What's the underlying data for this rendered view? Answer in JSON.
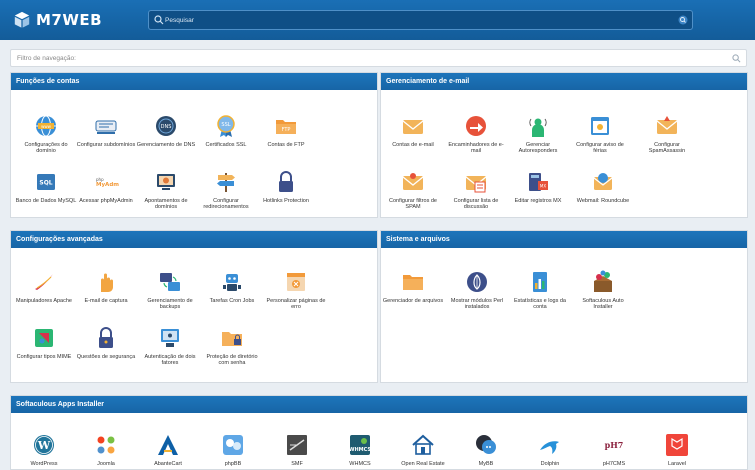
{
  "brand": {
    "name": "M7WEB"
  },
  "search": {
    "placeholder": "Pesquisar"
  },
  "filter": {
    "placeholder": "Filtro de navegação:"
  },
  "sections": {
    "contas": {
      "title": "Funções de contas",
      "items": [
        {
          "label": "Configurações do domínio",
          "icon": "globe-icon"
        },
        {
          "label": "Configurar subdomínios",
          "icon": "subdomain-icon"
        },
        {
          "label": "Gerenciamento de DNS",
          "icon": "dns-icon"
        },
        {
          "label": "Certificados SSL",
          "icon": "ssl-badge-icon"
        },
        {
          "label": "Contas de FTP",
          "icon": "ftp-folder-icon"
        },
        {
          "label": "Banco de Dados MySQL",
          "icon": "sql-database-icon"
        },
        {
          "label": "Acessar phpMyAdmin",
          "icon": "phpmyadmin-icon"
        },
        {
          "label": "Apontamentos de domínios",
          "icon": "domain-pointer-icon"
        },
        {
          "label": "Configurar redirecionamentos",
          "icon": "signpost-icon"
        },
        {
          "label": "Hotlinks Protection",
          "icon": "padlock-icon"
        }
      ]
    },
    "email": {
      "title": "Gerenciamento de e-mail",
      "items": [
        {
          "label": "Contas de e-mail",
          "icon": "envelope-icon"
        },
        {
          "label": "Encaminhadores de e-mail",
          "icon": "forwarder-icon"
        },
        {
          "label": "Gerenciar Autoresponders",
          "icon": "autoresponder-icon"
        },
        {
          "label": "Configurar aviso de férias",
          "icon": "vacation-notice-icon"
        },
        {
          "label": "Configurar SpamAssassin",
          "icon": "spam-envelope-icon"
        },
        {
          "label": "Configurar filtros de SPAM",
          "icon": "spam-filter-icon"
        },
        {
          "label": "Configurar lista de discussão",
          "icon": "mailing-list-icon"
        },
        {
          "label": "Editar registros MX",
          "icon": "mx-record-icon"
        },
        {
          "label": "Webmail: Roundcube",
          "icon": "roundcube-icon"
        }
      ]
    },
    "avancadas": {
      "title": "Configurações avançadas",
      "items": [
        {
          "label": "Manipuladores Apache",
          "icon": "apache-feather-icon"
        },
        {
          "label": "E-mail de captura",
          "icon": "hand-icon"
        },
        {
          "label": "Gerenciamento de backups",
          "icon": "backup-icon"
        },
        {
          "label": "Tarefas Cron Jobs",
          "icon": "robot-icon"
        },
        {
          "label": "Personalizar páginas de erro",
          "icon": "error-page-icon"
        },
        {
          "label": "Configurar tipos MIME",
          "icon": "mime-types-icon"
        },
        {
          "label": "Questões de segurança",
          "icon": "security-lock-icon"
        },
        {
          "label": "Autenticação de dois fatores",
          "icon": "two-factor-icon"
        },
        {
          "label": "Proteção de diretório com senha",
          "icon": "password-folder-icon"
        }
      ]
    },
    "sistema": {
      "title": "Sistema e arquivos",
      "items": [
        {
          "label": "Gerenciador de arquivos",
          "icon": "file-manager-icon"
        },
        {
          "label": "Mostrar módulos Perl instalados",
          "icon": "perl-onion-icon"
        },
        {
          "label": "Estatísticas e logs da conta",
          "icon": "statistics-icon"
        },
        {
          "label": "Softaculous Auto Installer",
          "icon": "softaculous-icon"
        }
      ]
    },
    "softaculous": {
      "title": "Softaculous Apps Installer",
      "items": [
        {
          "label": "WordPress",
          "icon": "wordpress-icon"
        },
        {
          "label": "Joomla",
          "icon": "joomla-icon"
        },
        {
          "label": "AbanteCart",
          "icon": "abantecart-icon"
        },
        {
          "label": "phpBB",
          "icon": "phpbb-icon"
        },
        {
          "label": "SMF",
          "icon": "smf-icon"
        },
        {
          "label": "WHMCS",
          "icon": "whmcs-icon"
        },
        {
          "label": "Open Real Estate",
          "icon": "real-estate-house-icon"
        },
        {
          "label": "MyBB",
          "icon": "mybb-icon"
        },
        {
          "label": "Dolphin",
          "icon": "dolphin-icon"
        },
        {
          "label": "pH7CMS",
          "icon": "ph7cms-icon"
        },
        {
          "label": "Laravel",
          "icon": "laravel-icon"
        }
      ]
    }
  }
}
